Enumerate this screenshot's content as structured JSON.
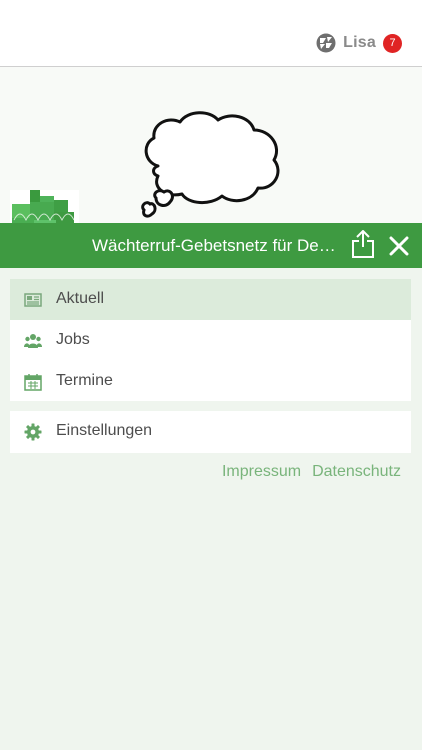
{
  "header": {
    "user_name": "Lisa",
    "notification_count": "7"
  },
  "app": {
    "title": "Wächterruf-Gebetsnetz für Deutschland"
  },
  "menu": {
    "items": [
      {
        "label": "Aktuell",
        "icon": "newspaper-icon",
        "active": true
      },
      {
        "label": "Jobs",
        "icon": "users-icon",
        "active": false
      },
      {
        "label": "Termine",
        "icon": "calendar-icon",
        "active": false
      }
    ],
    "settings": {
      "label": "Einstellungen",
      "icon": "gear-icon"
    }
  },
  "footer": {
    "impressum": "Impressum",
    "datenschutz": "Datenschutz"
  },
  "colors": {
    "brand_green": "#3e9a41",
    "active_row": "#dcebdb",
    "background": "#eff5ee",
    "badge_red": "#e02424",
    "link_green": "#79b47b"
  }
}
